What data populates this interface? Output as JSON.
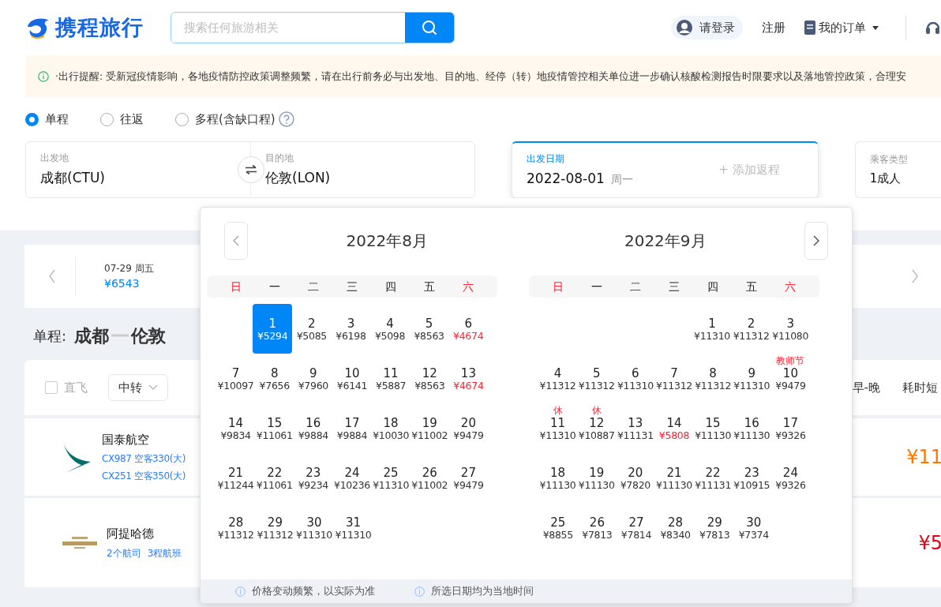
{
  "header": {
    "logo": "携程旅行",
    "search": {
      "placeholder": "搜索任何旅游相关"
    },
    "login": "请登录",
    "register": "注册",
    "orders": "我的订单"
  },
  "notice": "·出行提醒: 受新冠疫情影响，各地疫情防控政策调整频繁，请在出行前务必与出发地、目的地、经停（转）地疫情管控相关单位进一步确认核酸检测报告时限要求以及落地管控政策，合理安",
  "trip_types": [
    {
      "label": "单程",
      "selected": true
    },
    {
      "label": "往返",
      "selected": false
    },
    {
      "label": "多程(含缺口程)",
      "selected": false
    }
  ],
  "form": {
    "from": {
      "label": "出发地",
      "value": "成都(CTU)"
    },
    "to": {
      "label": "目的地",
      "value": "伦敦(LON)"
    },
    "date": {
      "label": "出发日期",
      "value": "2022-08-01",
      "weekday": "周一",
      "add_return": "+ 添加返程",
      "active": true
    },
    "passengers": {
      "label": "乘客类型",
      "value": "1成人"
    }
  },
  "date_strip": {
    "date": "07-29 周五",
    "price": "¥6543"
  },
  "route": {
    "prefix": "单程:",
    "from": "成都",
    "to": "伦敦"
  },
  "filters": {
    "direct": {
      "label": "直飞",
      "checked": false
    },
    "transfer": "中转",
    "sort": [
      "早-晚",
      "耗时短"
    ]
  },
  "flights": [
    {
      "airline": "国泰航空",
      "kind": "swoosh",
      "details": [
        "CX987 空客330(大)",
        "CX251 空客350(大)"
      ],
      "price": "¥11",
      "color": "#ff7700"
    },
    {
      "airline": "阿提哈德",
      "kind": "wordmark",
      "details": [
        "2个航司",
        "3程航班"
      ],
      "price": "¥5",
      "color": "#e60012"
    }
  ],
  "calendar": {
    "months": [
      {
        "title": "2022年8月",
        "weekdays": [
          {
            "label": "日",
            "weekend": true
          },
          {
            "label": "一",
            "weekend": false
          },
          {
            "label": "二",
            "weekend": false
          },
          {
            "label": "三",
            "weekend": false
          },
          {
            "label": "四",
            "weekend": false
          },
          {
            "label": "五",
            "weekend": false
          },
          {
            "label": "六",
            "weekend": true
          }
        ],
        "weeks": [
          {
            "kind": "lead",
            "days": [
              {
                "day": "1",
                "price": "¥5294",
                "selected": true,
                "low": false
              },
              {
                "day": "2",
                "price": "¥5085",
                "selected": false,
                "low": false
              },
              {
                "day": "3",
                "price": "¥6198",
                "selected": false,
                "low": false
              },
              {
                "day": "4",
                "price": "¥5098",
                "selected": false,
                "low": false
              },
              {
                "day": "5",
                "price": "¥8563",
                "selected": false,
                "low": false
              },
              {
                "day": "6",
                "price": "¥4674",
                "selected": false,
                "low": true
              }
            ]
          },
          {
            "kind": "full",
            "days": [
              {
                "day": "7",
                "price": "¥10097",
                "selected": false,
                "low": false
              },
              {
                "day": "8",
                "price": "¥7656",
                "selected": false,
                "low": false
              },
              {
                "day": "9",
                "price": "¥7960",
                "selected": false,
                "low": false
              },
              {
                "day": "10",
                "price": "¥6141",
                "selected": false,
                "low": false
              },
              {
                "day": "11",
                "price": "¥5887",
                "selected": false,
                "low": false
              },
              {
                "day": "12",
                "price": "¥8563",
                "selected": false,
                "low": false
              },
              {
                "day": "13",
                "price": "¥4674",
                "selected": false,
                "low": true
              }
            ]
          },
          {
            "kind": "full",
            "days": [
              {
                "day": "14",
                "price": "¥9834",
                "selected": false,
                "low": false
              },
              {
                "day": "15",
                "price": "¥11061",
                "selected": false,
                "low": false
              },
              {
                "day": "16",
                "price": "¥9884",
                "selected": false,
                "low": false
              },
              {
                "day": "17",
                "price": "¥9884",
                "selected": false,
                "low": false
              },
              {
                "day": "18",
                "price": "¥10030",
                "selected": false,
                "low": false
              },
              {
                "day": "19",
                "price": "¥11002",
                "selected": false,
                "low": false
              },
              {
                "day": "20",
                "price": "¥9479",
                "selected": false,
                "low": false
              }
            ]
          },
          {
            "kind": "full",
            "days": [
              {
                "day": "21",
                "price": "¥11244",
                "selected": false,
                "low": false
              },
              {
                "day": "22",
                "price": "¥11061",
                "selected": false,
                "low": false
              },
              {
                "day": "23",
                "price": "¥9234",
                "selected": false,
                "low": false
              },
              {
                "day": "24",
                "price": "¥10236",
                "selected": false,
                "low": false
              },
              {
                "day": "25",
                "price": "¥11310",
                "selected": false,
                "low": false
              },
              {
                "day": "26",
                "price": "¥11002",
                "selected": false,
                "low": false
              },
              {
                "day": "27",
                "price": "¥9479",
                "selected": false,
                "low": false
              }
            ]
          },
          {
            "kind": "full",
            "days": [
              {
                "day": "28",
                "price": "¥11312",
                "selected": false,
                "low": false
              },
              {
                "day": "29",
                "price": "¥11312",
                "selected": false,
                "low": false
              },
              {
                "day": "30",
                "price": "¥11310",
                "selected": false,
                "low": false
              },
              {
                "day": "31",
                "price": "¥11310",
                "selected": false,
                "low": false
              }
            ]
          }
        ]
      },
      {
        "title": "2022年9月",
        "weekdays": [
          {
            "label": "日",
            "weekend": true
          },
          {
            "label": "一",
            "weekend": false
          },
          {
            "label": "二",
            "weekend": false
          },
          {
            "label": "三",
            "weekend": false
          },
          {
            "label": "四",
            "weekend": false
          },
          {
            "label": "五",
            "weekend": false
          },
          {
            "label": "六",
            "weekend": true
          }
        ],
        "weeks": [
          {
            "kind": "lead",
            "days": [
              {
                "day": "1",
                "price": "¥11310",
                "selected": false,
                "low": false
              },
              {
                "day": "2",
                "price": "¥11312",
                "selected": false,
                "low": false
              },
              {
                "day": "3",
                "price": "¥11080",
                "selected": false,
                "low": false
              }
            ]
          },
          {
            "kind": "full",
            "days": [
              {
                "day": "4",
                "price": "¥11312",
                "selected": false,
                "low": false
              },
              {
                "day": "5",
                "price": "¥11312",
                "selected": false,
                "low": false
              },
              {
                "day": "6",
                "price": "¥11310",
                "selected": false,
                "low": false
              },
              {
                "day": "7",
                "price": "¥11312",
                "selected": false,
                "low": false
              },
              {
                "day": "8",
                "price": "¥11312",
                "selected": false,
                "low": false
              },
              {
                "day": "9",
                "price": "¥11310",
                "selected": false,
                "low": false
              },
              {
                "day": "10",
                "price": "¥9479",
                "selected": false,
                "low": false,
                "note": "教师节"
              }
            ]
          },
          {
            "kind": "full",
            "days": [
              {
                "day": "11",
                "price": "¥11310",
                "selected": false,
                "low": false,
                "note": "休"
              },
              {
                "day": "12",
                "price": "¥10887",
                "selected": false,
                "low": false,
                "note": "休"
              },
              {
                "day": "13",
                "price": "¥11131",
                "selected": false,
                "low": false
              },
              {
                "day": "14",
                "price": "¥5808",
                "selected": false,
                "low": true
              },
              {
                "day": "15",
                "price": "¥11130",
                "selected": false,
                "low": false
              },
              {
                "day": "16",
                "price": "¥11130",
                "selected": false,
                "low": false
              },
              {
                "day": "17",
                "price": "¥9326",
                "selected": false,
                "low": false
              }
            ]
          },
          {
            "kind": "full",
            "days": [
              {
                "day": "18",
                "price": "¥11130",
                "selected": false,
                "low": false
              },
              {
                "day": "19",
                "price": "¥11130",
                "selected": false,
                "low": false
              },
              {
                "day": "20",
                "price": "¥7820",
                "selected": false,
                "low": false
              },
              {
                "day": "21",
                "price": "¥11130",
                "selected": false,
                "low": false
              },
              {
                "day": "22",
                "price": "¥11131",
                "selected": false,
                "low": false
              },
              {
                "day": "23",
                "price": "¥10915",
                "selected": false,
                "low": false
              },
              {
                "day": "24",
                "price": "¥9326",
                "selected": false,
                "low": false
              }
            ]
          },
          {
            "kind": "full",
            "days": [
              {
                "day": "25",
                "price": "¥8855",
                "selected": false,
                "low": false
              },
              {
                "day": "26",
                "price": "¥7813",
                "selected": false,
                "low": false
              },
              {
                "day": "27",
                "price": "¥7814",
                "selected": false,
                "low": false
              },
              {
                "day": "28",
                "price": "¥8340",
                "selected": false,
                "low": false
              },
              {
                "day": "29",
                "price": "¥7813",
                "selected": false,
                "low": false
              },
              {
                "day": "30",
                "price": "¥7374",
                "selected": false,
                "low": false
              }
            ]
          }
        ]
      }
    ],
    "footer": [
      "价格变动频繁，以实际为准",
      "所选日期均为当地时间"
    ]
  }
}
